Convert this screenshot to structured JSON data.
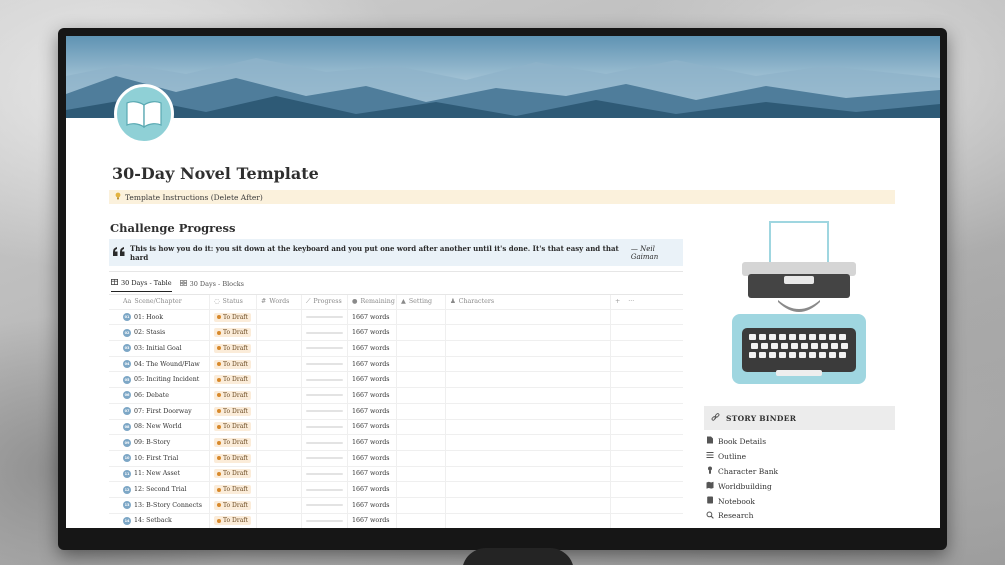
{
  "page": {
    "title": "30-Day Novel Template",
    "callout": "Template Instructions (Delete After)",
    "section_heading": "Challenge Progress",
    "quote": {
      "text": "This is how you do it: you sit down at the keyboard and you put one word after another until it's done. It's that easy and that hard",
      "author": "— Neil Gaiman"
    }
  },
  "tabs": [
    {
      "label": "30 Days - Table",
      "icon": "table-icon",
      "active": true
    },
    {
      "label": "30 Days - Blocks",
      "icon": "gallery-icon",
      "active": false
    }
  ],
  "table": {
    "columns": {
      "name": "Scene/Chapter",
      "status": "Status",
      "words": "Words",
      "progress": "Progress",
      "remaining": "Remaining",
      "setting": "Setting",
      "characters": "Characters",
      "add": "+",
      "more": "···"
    },
    "rows": [
      {
        "badge": "01",
        "name": "01: Hook",
        "status": "To Draft",
        "progress": 0.0,
        "remaining": "1667 words"
      },
      {
        "badge": "02",
        "name": "02: Stasis",
        "status": "To Draft",
        "progress": 0.0,
        "remaining": "1667 words"
      },
      {
        "badge": "03",
        "name": "03: Initial Goal",
        "status": "To Draft",
        "progress": 0.0,
        "remaining": "1667 words"
      },
      {
        "badge": "04",
        "name": "04: The Wound/Flaw",
        "status": "To Draft",
        "progress": 0.0,
        "remaining": "1667 words"
      },
      {
        "badge": "05",
        "name": "05: Inciting Incident",
        "status": "To Draft",
        "progress": 0.0,
        "remaining": "1667 words"
      },
      {
        "badge": "06",
        "name": "06: Debate",
        "status": "To Draft",
        "progress": 0.0,
        "remaining": "1667 words"
      },
      {
        "badge": "07",
        "name": "07: First Doorway",
        "status": "To Draft",
        "progress": 0.0,
        "remaining": "1667 words"
      },
      {
        "badge": "08",
        "name": "08: New World",
        "status": "To Draft",
        "progress": 0.0,
        "remaining": "1667 words"
      },
      {
        "badge": "09",
        "name": "09: B-Story",
        "status": "To Draft",
        "progress": 0.0,
        "remaining": "1667 words"
      },
      {
        "badge": "10",
        "name": "10: First Trial",
        "status": "To Draft",
        "progress": 0.0,
        "remaining": "1667 words"
      },
      {
        "badge": "11",
        "name": "11: New Asset",
        "status": "To Draft",
        "progress": 0.0,
        "remaining": "1667 words"
      },
      {
        "badge": "12",
        "name": "12: Second Trial",
        "status": "To Draft",
        "progress": 0.0,
        "remaining": "1667 words"
      },
      {
        "badge": "13",
        "name": "13: B-Story Connects",
        "status": "To Draft",
        "progress": 0.0,
        "remaining": "1667 words"
      },
      {
        "badge": "14",
        "name": "14: Setback",
        "status": "To Draft",
        "progress": 0.0,
        "remaining": "1667 words"
      }
    ]
  },
  "binder": {
    "title": "STORY BINDER",
    "items": [
      {
        "label": "Book Details",
        "icon": "document-icon"
      },
      {
        "label": "Outline",
        "icon": "list-icon"
      },
      {
        "label": "Character Bank",
        "icon": "person-icon"
      },
      {
        "label": "Worldbuilding",
        "icon": "map-icon"
      },
      {
        "label": "Notebook",
        "icon": "notebook-icon"
      },
      {
        "label": "Research",
        "icon": "search-icon"
      }
    ]
  },
  "colors": {
    "banner_sky": "#dbeaf1",
    "banner_mountains": "#2e5a76",
    "page_icon_bg": "#8fd0d6",
    "callout_bg": "#fbf1dc",
    "quote_bg": "#eaf2f8",
    "status_pill_bg": "#fbecd9",
    "status_dot": "#d8892b",
    "typewriter_body": "#9fd6e0"
  }
}
